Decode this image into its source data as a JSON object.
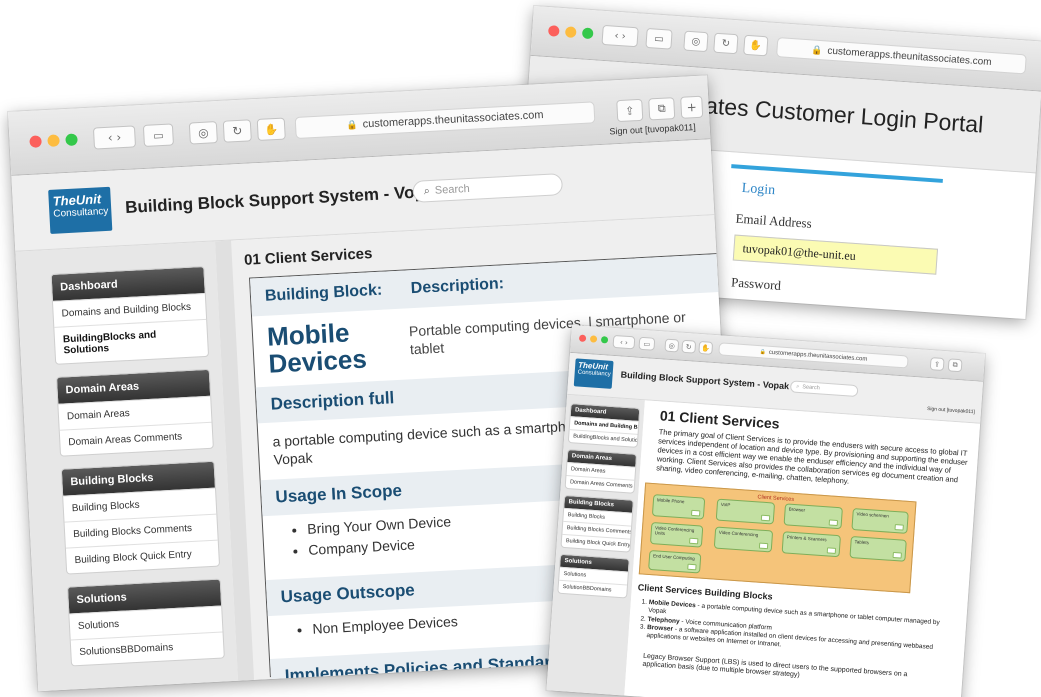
{
  "colors": {
    "accent": "#1e6fa6",
    "heading_blue": "#1a4d73",
    "login_blue": "#2e86c7",
    "diagram_orange": "#f5c47a",
    "diagram_green": "#c3e0a2",
    "input_yellow": "#fbfbb3"
  },
  "main": {
    "url": "customerapps.theunitassociates.com",
    "signout": "Sign out [tuvopak011]",
    "logo_line1": "TheUnit",
    "logo_line2": "Consultancy",
    "app_title": "Building Block Support System - Vopak",
    "search_placeholder": "Search",
    "sidebar": [
      {
        "title": "Dashboard",
        "items": [
          "Domains and Building Blocks",
          "BuildingBlocks and Solutions"
        ]
      },
      {
        "title": "Domain Areas",
        "items": [
          "Domain Areas",
          "Domain Areas Comments"
        ]
      },
      {
        "title": "Building Blocks",
        "items": [
          "Building Blocks",
          "Building Blocks Comments",
          "Building Block Quick Entry"
        ]
      },
      {
        "title": "Solutions",
        "items": [
          "Solutions",
          "SolutionsBBDomains"
        ]
      }
    ],
    "page_title": "01 Client Services",
    "bb_label": "Building Block:",
    "desc_label": "Description:",
    "bb_name": "Mobile Devices",
    "bb_description": "Portable computing devices, l smartphone or tablet",
    "description_full_title": "Description full",
    "description_full_text": "a portable computing device such as a smartphone o managed by Vopak",
    "usage_in_scope_title": "Usage In Scope",
    "usage_in_scope": [
      "Bring Your Own Device",
      "Company Device"
    ],
    "usage_outscope_title": "Usage Outscope",
    "usage_outscope": [
      "Non Employee Devices"
    ],
    "policies_title": "Implements Policies and Standards"
  },
  "login": {
    "url": "customerapps.theunitassociates.com",
    "portal_title": "The Unit Associates Customer Login Portal",
    "login_label": "Login",
    "email_label": "Email Address",
    "email_value": "tuvopak01@the-unit.eu",
    "password_label": "Password"
  },
  "third": {
    "url": "customerapps.theunitassociates.com",
    "logo_line1": "TheUnit",
    "logo_line2": "Consultancy",
    "app_title": "Building Block Support System - Vopak",
    "search_placeholder": "Search",
    "signout": "Sign out [tuvopak011]",
    "sidebar": [
      {
        "title": "Dashboard",
        "items": [
          "Domains and Building Blocks",
          "BuildingBlocks and Solutions"
        ]
      },
      {
        "title": "Domain Areas",
        "items": [
          "Domain Areas",
          "Domain Areas Comments"
        ]
      },
      {
        "title": "Building Blocks",
        "items": [
          "Building Blocks",
          "Building Blocks Comments",
          "Building Block Quick Entry"
        ]
      },
      {
        "title": "Solutions",
        "items": [
          "Solutions",
          "SolutionBBDomains"
        ]
      }
    ],
    "page_title": "01 Client Services",
    "intro": "The primary goal of Client Services is to provide the endusers with secure access to global IT services independent of location and device type. By provisioning and supporting the enduser devices in a cost efficient way we enable the enduser efficiency and the individual way of working. Client Services also provides the collaboration services eg document creation and sharing, video conferencing, e-mailing, chatten, telephony.",
    "diagram_title": "Client Services",
    "diagram_boxes": [
      "Mobile Phone",
      "VoIP",
      "Browser",
      "Video schermen",
      "Video Conferencing Units",
      "Video Conferencing",
      "Printers & Scanners",
      "Tablets",
      "End User Computing"
    ],
    "blocks_title": "Client Services Building Blocks",
    "blocks": [
      {
        "name": "Mobile Devices",
        "text": " - a portable computing device such as a smartphone or tablet computer managed by Vopak"
      },
      {
        "name": "Telephony",
        "text": " - Voice communication platform"
      },
      {
        "name": "Browser",
        "text": " - a software application installed on client devices for accessing and presenting webbased applications or websites on Internet or Intranet."
      }
    ],
    "footer": "Legacy Browser Support (LBS) is used to direct users to the supported browsers on a application basis (due to multiple browser strategy)"
  }
}
